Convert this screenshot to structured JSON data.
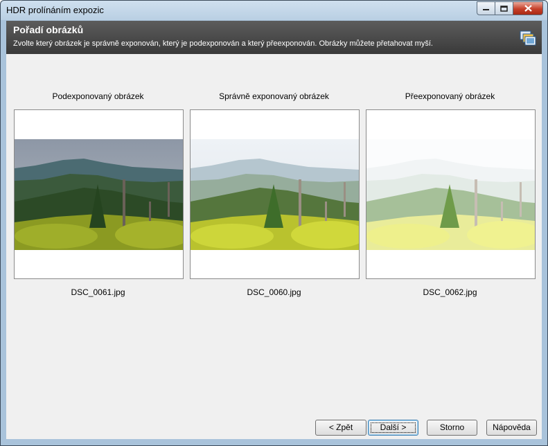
{
  "window": {
    "title": "HDR prolínáním expozic"
  },
  "header": {
    "title": "Pořadí obrázků",
    "subtitle": "Zvolte který obrázek je správně exponován, který je podexponován a který přeexponován. Obrázky můžete přetahovat myší."
  },
  "images": [
    {
      "label": "Podexponovaný obrázek",
      "filename": "DSC_0061.jpg",
      "exposure": "under"
    },
    {
      "label": "Správně exponovaný obrázek",
      "filename": "DSC_0060.jpg",
      "exposure": "normal"
    },
    {
      "label": "Přeexponovaný obrázek",
      "filename": "DSC_0062.jpg",
      "exposure": "over"
    }
  ],
  "buttons": {
    "back": "< Zpět",
    "next": "Další >",
    "cancel": "Storno",
    "help": "Nápověda"
  },
  "icons": [
    "minimize-icon",
    "maximize-icon",
    "close-icon",
    "wizard-images-icon"
  ]
}
